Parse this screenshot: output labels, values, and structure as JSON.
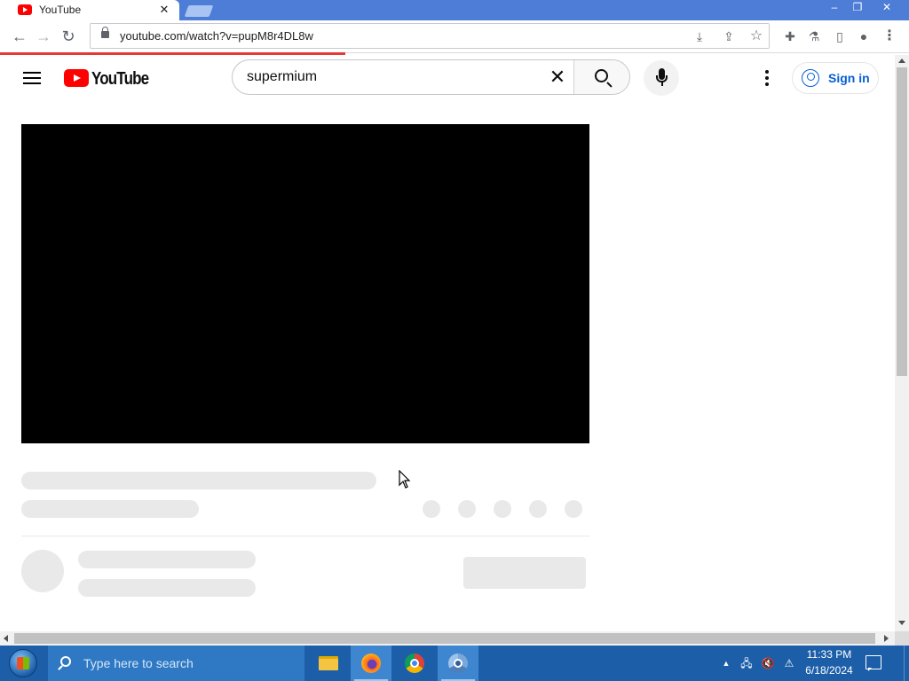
{
  "browser": {
    "tab": {
      "title": "YouTube",
      "close_glyph": "✕"
    },
    "window_controls": {
      "minimize": "‒",
      "maximize": "❐",
      "close": "✕"
    },
    "nav": {
      "back": "←",
      "forward": "→",
      "reload": "↻"
    },
    "url": "youtube.com/watch?v=pupM8r4DL8w",
    "icons": [
      "lock-icon",
      "install-icon",
      "share-icon",
      "star-icon",
      "extensions-icon",
      "labs-icon",
      "side-panel-icon",
      "profile-icon",
      "chrome-menu-icon"
    ],
    "toolbar_glyphs": {
      "install": "⤓",
      "share": "⇪",
      "star": "☆",
      "extensions": "✚",
      "labs": "⚗",
      "side_panel": "▯",
      "profile": "●",
      "menu": "⋮"
    },
    "loading_progress": 0.38
  },
  "youtube": {
    "logo_text": "YouTube",
    "search": {
      "value": "supermium",
      "clear_glyph": "✕"
    },
    "signin_label": "Sign in",
    "player": {
      "state": "loading",
      "color": "#000000"
    }
  },
  "taskbar": {
    "search_placeholder": "Type here to search",
    "apps": [
      "file-explorer",
      "firefox",
      "chrome",
      "chromium"
    ],
    "tray": {
      "chevron": "▲",
      "network": "🖧",
      "volume": "🔇",
      "security": "⚠"
    },
    "time": "11:33 PM",
    "date": "6/18/2024"
  },
  "colors": {
    "tabstrip": "#4d7dd6",
    "youtube_red": "#ff0000",
    "signin_blue": "#065fd4",
    "taskbar": "#1c5fa8",
    "skeleton": "#e9e9e9"
  }
}
